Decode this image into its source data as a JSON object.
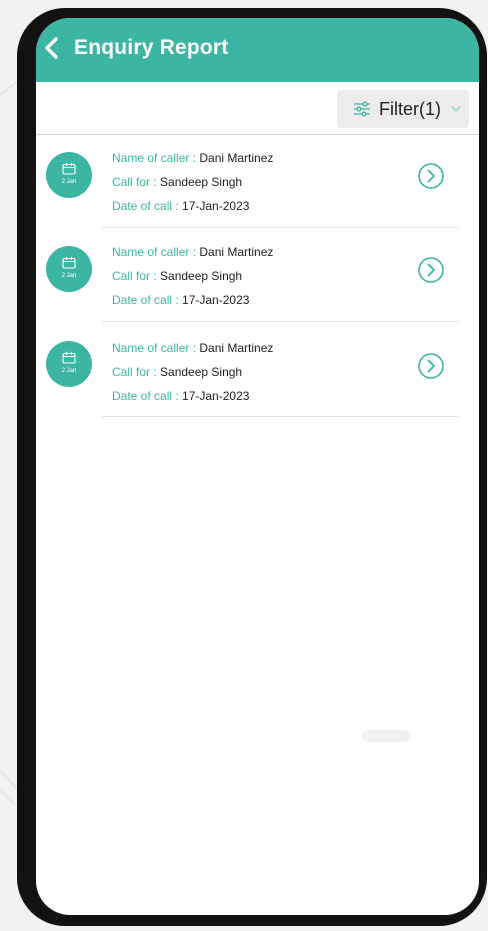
{
  "header": {
    "title": "Enquiry Report"
  },
  "toolbar": {
    "filter_label": "Filter(1)"
  },
  "enquiries": [
    {
      "date_badge": "2 Jan",
      "caller_label": "Name of caller : ",
      "caller_value": "Dani Martinez",
      "callfor_label": "Call for : ",
      "callfor_value": "Sandeep Singh",
      "date_label": "Date of call : ",
      "date_value": "17-Jan-2023"
    },
    {
      "date_badge": "2 Jan",
      "caller_label": "Name of caller : ",
      "caller_value": "Dani Martinez",
      "callfor_label": "Call for : ",
      "callfor_value": "Sandeep Singh",
      "date_label": "Date of call : ",
      "date_value": "17-Jan-2023"
    },
    {
      "date_badge": "2 Jan",
      "caller_label": "Name of caller : ",
      "caller_value": "Dani Martinez",
      "callfor_label": "Call for : ",
      "callfor_value": "Sandeep Singh",
      "date_label": "Date of call : ",
      "date_value": "17-Jan-2023"
    }
  ],
  "colors": {
    "accent": "#3cb6a3",
    "header_text": "#ffffff",
    "value_text": "#222222",
    "filter_bg": "#ececec",
    "phone_frame": "#121212"
  },
  "icons": {
    "back": "chevron-left-icon",
    "filter": "sliders-icon",
    "dropdown": "chevron-down-icon",
    "date": "calendar-icon",
    "open": "chevron-right-circle-icon"
  }
}
